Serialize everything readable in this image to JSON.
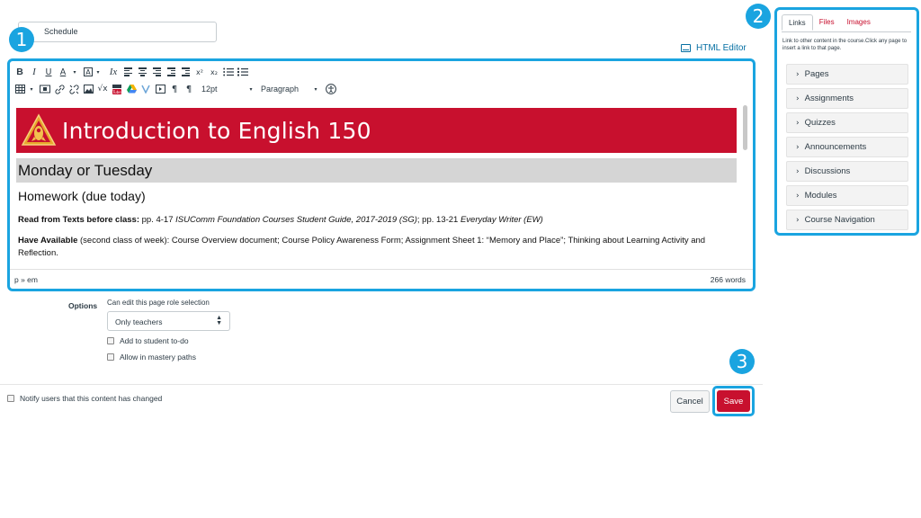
{
  "title_field": {
    "value": "Schedule"
  },
  "callouts": [
    "1",
    "2",
    "3"
  ],
  "html_editor": {
    "label": "HTML Editor",
    "icon": "keyboard-icon"
  },
  "toolbar": {
    "row1": [
      "B",
      "I",
      "U",
      "A",
      "▾",
      "A",
      "▾",
      "Ix",
      "align-left",
      "align-center",
      "align-right",
      "indent",
      "outdent",
      "x²",
      "x₂",
      "bullet-list",
      "numbered-list"
    ],
    "row2_icons": [
      "table-icon",
      "media-icon",
      "link-icon",
      "unlink-icon",
      "image-icon",
      "math-icon",
      "youtube-icon",
      "google-drive-icon",
      "lti-icon",
      "embed-icon",
      "ltr-icon",
      "rtl-icon"
    ],
    "font_size": "12pt",
    "block_format": "Paragraph"
  },
  "content": {
    "banner_title": "Introduction to English 150",
    "day_heading": "Monday or Tuesday",
    "homework_heading": "Homework (due today)",
    "para1": {
      "bold": "Read from Texts before class:",
      "text1": " pp. 4-17 ",
      "italic1": "ISUComm Foundation Courses Student Guide, 2017-2019 (SG)",
      "text2": "; pp. 13-21 ",
      "italic2": "Everyday Writer (EW)"
    },
    "para2": {
      "bold": "Have Available",
      "text": " (second class of week): Course Overview document; Course Policy Awareness Form; Assignment Sheet 1: “Memory and Place”; Thinking about Learning Activity and Reflection."
    }
  },
  "status_bar": {
    "path": "p » em",
    "word_count": "266 words"
  },
  "options": {
    "label": "Options",
    "help": "Can edit this page role selection",
    "role_selected": "Only teachers",
    "todo_label": "Add to student to-do",
    "mastery_label": "Allow in mastery paths"
  },
  "notify_label": "Notify users that this content has changed",
  "buttons": {
    "cancel": "Cancel",
    "save": "Save"
  },
  "sidebar": {
    "tabs": [
      "Links",
      "Files",
      "Images"
    ],
    "help": "Link to other content in the course.Click any page to insert a link to that page.",
    "items": [
      "Pages",
      "Assignments",
      "Quizzes",
      "Announcements",
      "Discussions",
      "Modules",
      "Course Navigation"
    ]
  },
  "colors": {
    "accent": "#1aa4e0",
    "brand_red": "#c8102e",
    "link_blue": "#0770a3"
  }
}
